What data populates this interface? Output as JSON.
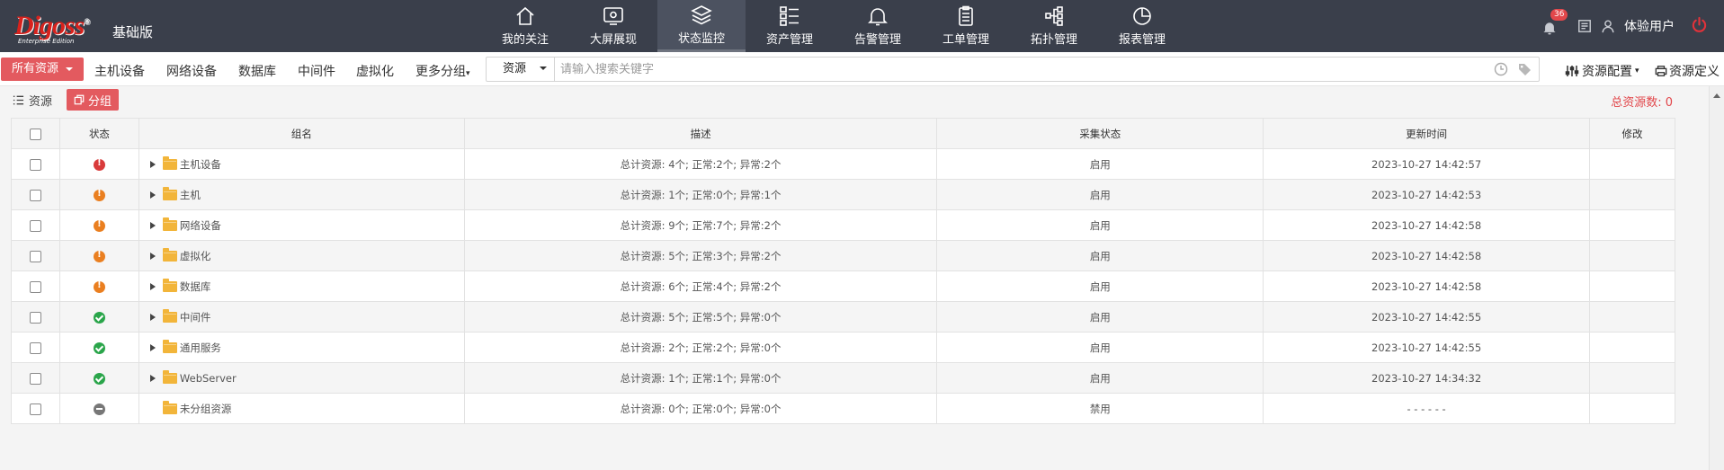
{
  "logo": {
    "brand": "Digoss",
    "registered": "®",
    "tagline": "Enterprise Edition",
    "edition": "基础版"
  },
  "nav": [
    {
      "label": "我的关注",
      "icon": "home-icon"
    },
    {
      "label": "大屏展现",
      "icon": "monitor-icon"
    },
    {
      "label": "状态监控",
      "icon": "layers-icon",
      "active": true
    },
    {
      "label": "资产管理",
      "icon": "list-icon"
    },
    {
      "label": "告警管理",
      "icon": "bell-icon"
    },
    {
      "label": "工单管理",
      "icon": "clipboard-icon"
    },
    {
      "label": "拓扑管理",
      "icon": "topology-icon"
    },
    {
      "label": "报表管理",
      "icon": "pie-chart-icon"
    }
  ],
  "topright": {
    "notifications": "36",
    "user": "体验用户"
  },
  "filter": {
    "primary": "所有资源",
    "tabs": [
      "主机设备",
      "网络设备",
      "数据库",
      "中间件",
      "虚拟化",
      "更多分组"
    ],
    "search_type": "资源",
    "search_placeholder": "请输入搜索关键字",
    "config": "资源配置",
    "define": "资源定义"
  },
  "view": {
    "resources": "资源",
    "groups": "分组",
    "total_label": "总资源数:",
    "total_value": "0"
  },
  "table": {
    "headers": {
      "status": "状态",
      "name": "组名",
      "desc": "描述",
      "collect": "采集状态",
      "updated": "更新时间",
      "edit": "修改"
    },
    "rows": [
      {
        "status": "err",
        "name": "主机设备",
        "desc": "总计资源: 4个; 正常:2个; 异常:2个",
        "collect": "启用",
        "updated": "2023-10-27 14:42:57",
        "expandable": true
      },
      {
        "status": "warn",
        "name": "主机",
        "desc": "总计资源: 1个; 正常:0个; 异常:1个",
        "collect": "启用",
        "updated": "2023-10-27 14:42:53",
        "expandable": true
      },
      {
        "status": "warn",
        "name": "网络设备",
        "desc": "总计资源: 9个; 正常:7个; 异常:2个",
        "collect": "启用",
        "updated": "2023-10-27 14:42:58",
        "expandable": true
      },
      {
        "status": "warn",
        "name": "虚拟化",
        "desc": "总计资源: 5个; 正常:3个; 异常:2个",
        "collect": "启用",
        "updated": "2023-10-27 14:42:58",
        "expandable": true
      },
      {
        "status": "warn",
        "name": "数据库",
        "desc": "总计资源: 6个; 正常:4个; 异常:2个",
        "collect": "启用",
        "updated": "2023-10-27 14:42:58",
        "expandable": true
      },
      {
        "status": "ok",
        "name": "中间件",
        "desc": "总计资源: 5个; 正常:5个; 异常:0个",
        "collect": "启用",
        "updated": "2023-10-27 14:42:55",
        "expandable": true
      },
      {
        "status": "ok",
        "name": "通用服务",
        "desc": "总计资源: 2个; 正常:2个; 异常:0个",
        "collect": "启用",
        "updated": "2023-10-27 14:42:55",
        "expandable": true
      },
      {
        "status": "ok",
        "name": "WebServer",
        "desc": "总计资源: 1个; 正常:1个; 异常:0个",
        "collect": "启用",
        "updated": "2023-10-27 14:34:32",
        "expandable": true
      },
      {
        "status": "off",
        "name": "未分组资源",
        "desc": "总计资源: 0个; 正常:0个; 异常:0个",
        "collect": "禁用",
        "updated": "- - - - - -",
        "expandable": false
      }
    ]
  }
}
